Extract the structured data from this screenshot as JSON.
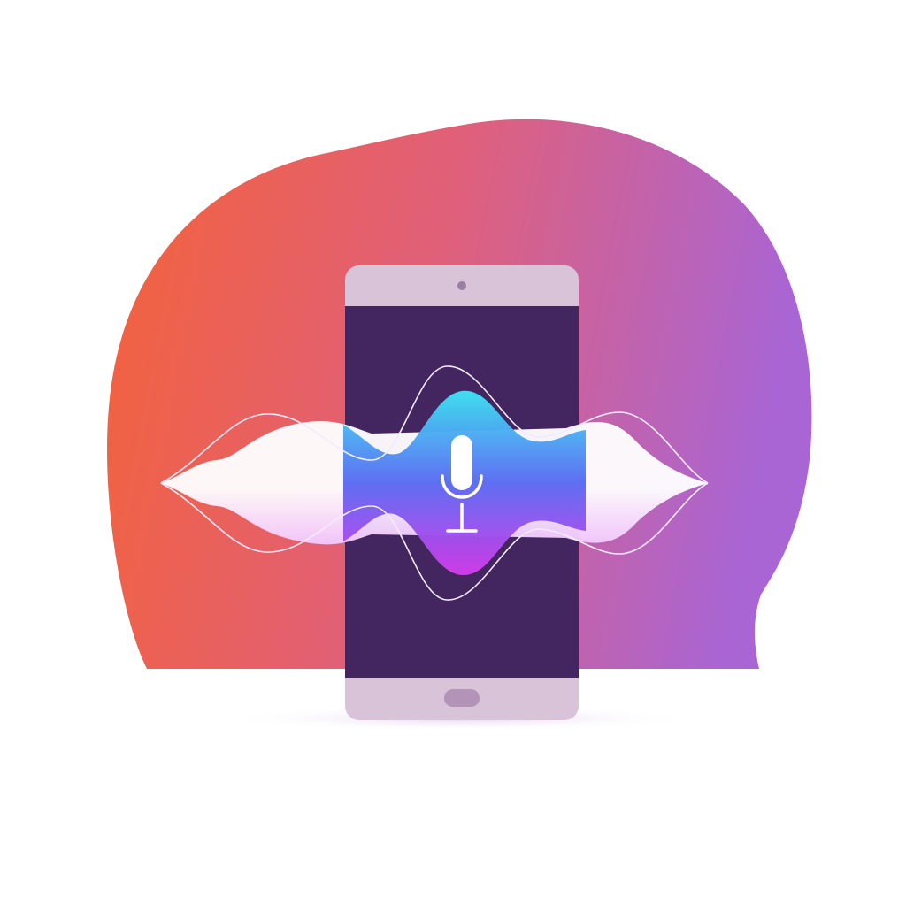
{
  "illustration": {
    "subject": "smartphone-voice-assistant",
    "icons": [
      "microphone-icon",
      "front-camera-icon",
      "home-button-icon"
    ],
    "colors": {
      "blob_start": "#F4623A",
      "blob_mid": "#E0607A",
      "blob_end": "#A965D4",
      "phone_frame": "#D9C3D9",
      "phone_screen": "#43255F",
      "wave_cyan": "#3FE4F4",
      "wave_blue": "#5A6AF2",
      "wave_magenta": "#D43CEB",
      "wave_outline": "#F4E9FF",
      "shadow": "#E9E0F2"
    }
  }
}
